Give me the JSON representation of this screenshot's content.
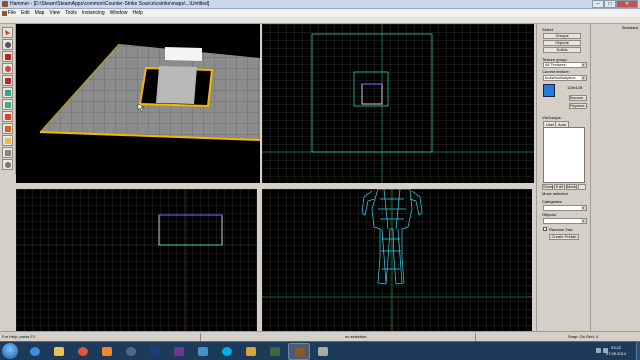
{
  "window": {
    "title": "Hammer - [D:\\Steam\\SteamApps\\common\\Counter-Strike Source\\cstrike\\maps\\...\\Untitled]",
    "controls": [
      "–",
      "□",
      "✕"
    ]
  },
  "menu": [
    "File",
    "Edit",
    "Map",
    "View",
    "Tools",
    "Instancing",
    "Window",
    "Help"
  ],
  "viewports": {
    "camera": {
      "label": "camera"
    },
    "top": {
      "label": "top (x/y)"
    },
    "front": {
      "label": "front (y/z)"
    },
    "side": {
      "label": "side (x/z)"
    }
  },
  "right_panel": {
    "select_label": "Select",
    "groups_button": "Groups",
    "objects_button": "Objects",
    "solids_button": "Solids",
    "texture_group_label": "Texture group:",
    "texture_group_value": "All Textures",
    "current_texture_label": "Current texture:",
    "current_texture_value": "tools/toolsskybox",
    "texture_size": "128x128",
    "browse_button": "Browse...",
    "replace_button": "Replace...",
    "visgroups_label": "VisGroups:",
    "tab_user": "User",
    "tab_auto": "Auto",
    "show_button": "Show",
    "edit_button": "Edit",
    "mark_button": "Mark",
    "move_selected_label": "Move selected",
    "categories_label": "Categories:",
    "objects_label": "Objects:",
    "random_yaw_label": "Random Yaw",
    "create_prefab_button": "Create Prefab",
    "secondary_header": "Standard"
  },
  "status": {
    "help": "For Help, press F1",
    "selection": "no selection.",
    "snap": "Snap: On Grid: 4"
  },
  "taskbar": {
    "time": "03:22",
    "date": "07.09.2014"
  }
}
